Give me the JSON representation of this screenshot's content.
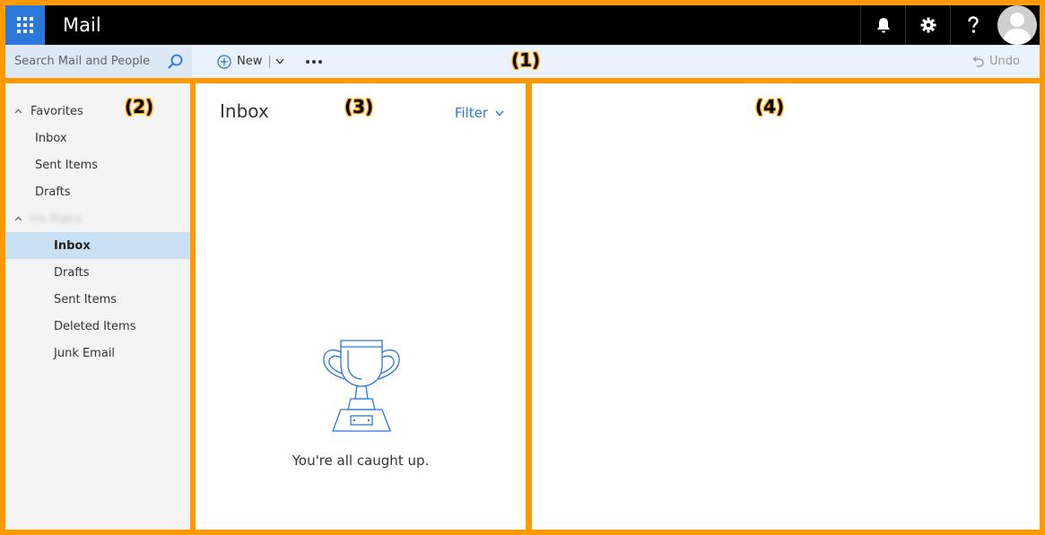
{
  "header": {
    "app_title": "Mail",
    "icons": [
      "waffle-icon",
      "bell-icon",
      "gear-icon",
      "help-icon",
      "avatar"
    ]
  },
  "commandbar": {
    "search_placeholder": "Search Mail and People",
    "new_label": "New",
    "separator": "|",
    "undo_label": "Undo"
  },
  "sidebar": {
    "favorites_label": "Favorites",
    "favorites": [
      "Inbox",
      "Sent Items",
      "Drafts"
    ],
    "account_label": "Iris Blakis",
    "account_items": [
      {
        "label": "Inbox"
      },
      {
        "label": "Drafts"
      },
      {
        "label": "Sent Items"
      },
      {
        "label": "Deleted Items"
      },
      {
        "label": "Junk Email"
      }
    ]
  },
  "message_list": {
    "title": "Inbox",
    "filter_label": "Filter",
    "empty_message": "You're all caught up."
  },
  "markers": [
    "(1)",
    "(2)",
    "(3)",
    "(4)"
  ],
  "colors": {
    "accent": "#2b78d8",
    "highlight_border": "#ff9900",
    "selected_bg": "#c7e0f4"
  }
}
